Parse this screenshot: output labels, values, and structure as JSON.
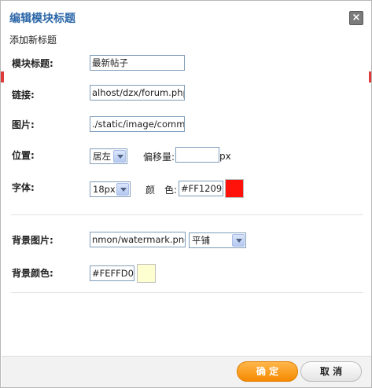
{
  "dialog": {
    "title": "编辑模块标题",
    "close_label": "×",
    "subtitle": "添加新标题"
  },
  "form": {
    "module_title": {
      "label": "模块标题:",
      "value": "最新帖子"
    },
    "link": {
      "label": "链接:",
      "value": "alhost/dzx/forum.php"
    },
    "image": {
      "label": "图片:",
      "value": "./static/image/commc"
    },
    "position": {
      "label": "位置:",
      "selected": "居左",
      "offset_label": "偏移量:",
      "offset_value": "",
      "offset_unit": "px"
    },
    "font": {
      "label": "字体:",
      "size_selected": "18px",
      "color_label": "颜　色:",
      "color_value": "#FF1209",
      "color_swatch": "#FF1209"
    },
    "bg_image": {
      "label": "背景图片:",
      "value": "nmon/watermark.png",
      "repeat_selected": "平铺"
    },
    "bg_color": {
      "label": "背景颜色:",
      "value": "#FEFFD0",
      "color_swatch": "#FEFFD0"
    }
  },
  "footer": {
    "ok_label": "确 定",
    "cancel_label": "取 消"
  },
  "colors": {
    "title": "#2b66a8",
    "ok_button": "#f68a00"
  },
  "icons": {
    "close": "close-icon",
    "dropdown": "chevron-down-icon"
  }
}
